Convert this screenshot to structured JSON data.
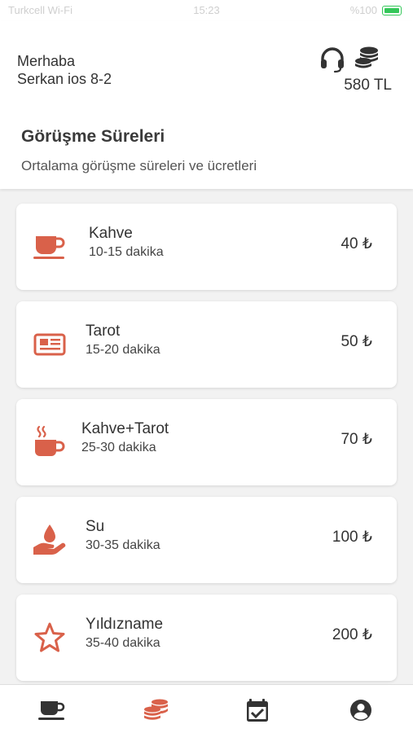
{
  "status_bar": {
    "carrier": "Turkcell Wi-Fi",
    "time": "15:23",
    "battery": "%100"
  },
  "header": {
    "greeting": "Merhaba",
    "user_name": "Serkan ios 8-2",
    "balance": "580 TL",
    "section_title": "Görüşme Süreleri",
    "section_subtitle": "Ortalama görüşme süreleri ve ücretleri"
  },
  "services": [
    {
      "name": "Kahve",
      "duration": "10-15 dakika",
      "price": "40 ₺",
      "icon": "coffee-cup-icon"
    },
    {
      "name": "Tarot",
      "duration": "15-20 dakika",
      "price": "50 ₺",
      "icon": "newspaper-icon"
    },
    {
      "name": "Kahve+Tarot",
      "duration": "25-30 dakika",
      "price": "70 ₺",
      "icon": "hot-mug-icon"
    },
    {
      "name": "Su",
      "duration": "30-35 dakika",
      "price": "100 ₺",
      "icon": "hand-water-drop-icon"
    },
    {
      "name": "Yıldızname",
      "duration": "35-40 dakika",
      "price": "200 ₺",
      "icon": "star-icon"
    }
  ],
  "bottom_nav": [
    {
      "icon": "coffee-icon",
      "active": false
    },
    {
      "icon": "coins-icon",
      "active": true
    },
    {
      "icon": "calendar-check-icon",
      "active": false
    },
    {
      "icon": "user-circle-icon",
      "active": false
    }
  ],
  "colors": {
    "accent": "#d9614a",
    "icon_dark": "#333333",
    "background": "#f2f2f2",
    "card": "#ffffff"
  }
}
